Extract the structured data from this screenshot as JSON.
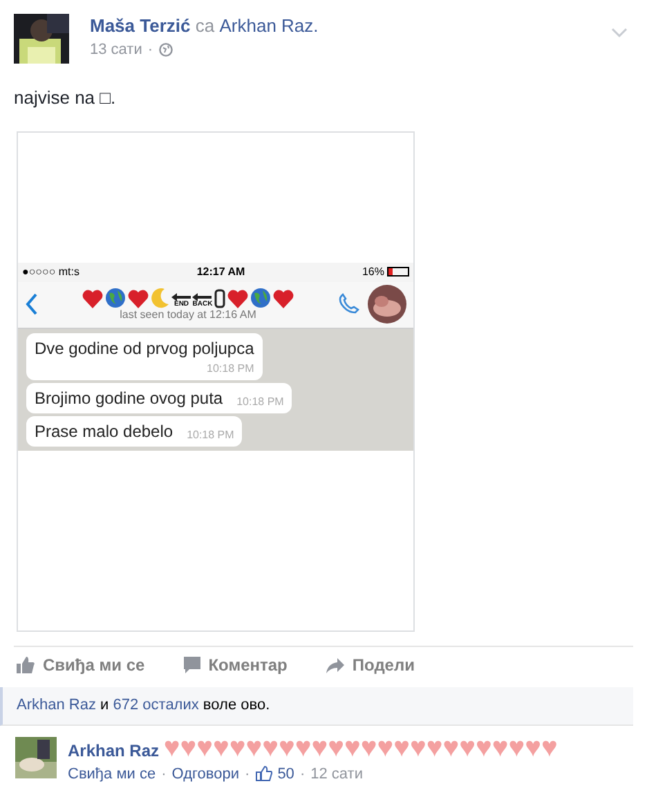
{
  "post": {
    "author": "Maša Terzić",
    "with_word": "са",
    "tagged": "Arkhan Raz.",
    "time": "13 сати",
    "separator": "·",
    "text": "najvise na □."
  },
  "shared_screenshot": {
    "status": {
      "carrier": "●○○○○ mt:s",
      "clock": "12:17 AM",
      "battery": "16%"
    },
    "header_emoji": [
      {
        "kind": "heart"
      },
      {
        "kind": "globe"
      },
      {
        "kind": "heart"
      },
      {
        "kind": "moon"
      },
      {
        "kind": "arrow",
        "label": "END"
      },
      {
        "kind": "arrow",
        "label": "BACK"
      },
      {
        "kind": "phone"
      },
      {
        "kind": "heart"
      },
      {
        "kind": "globe"
      },
      {
        "kind": "heart"
      }
    ],
    "last_seen": "last seen today at 12:16 AM",
    "messages": [
      {
        "text": "Dve godine od prvog poljupca",
        "time": "10:18 PM",
        "kind": "stacked"
      },
      {
        "text": "Brojimo godine ovog puta",
        "time": "10:18 PM",
        "kind": "inline"
      },
      {
        "text": "Prase malo debelo",
        "time": "10:18 PM",
        "kind": "inline"
      }
    ]
  },
  "actions": [
    {
      "kind": "like",
      "label": "Свиђа ми се"
    },
    {
      "kind": "comment",
      "label": "Коментар"
    },
    {
      "kind": "share",
      "label": "Подели"
    }
  ],
  "likes": {
    "name": "Arkhan Raz",
    "and": "и",
    "others": "672 осталих",
    "rest": "воле ово."
  },
  "comment": {
    "author": "Arkhan Raz",
    "text": "♥♥♥♥♥♥♥♥♥♥♥♥♥♥♥♥♥♥♥♥♥♥♥♥",
    "like": "Свиђа ми се",
    "reply": "Одговори",
    "likes": "50",
    "time": "12 сати",
    "separator": "·"
  }
}
